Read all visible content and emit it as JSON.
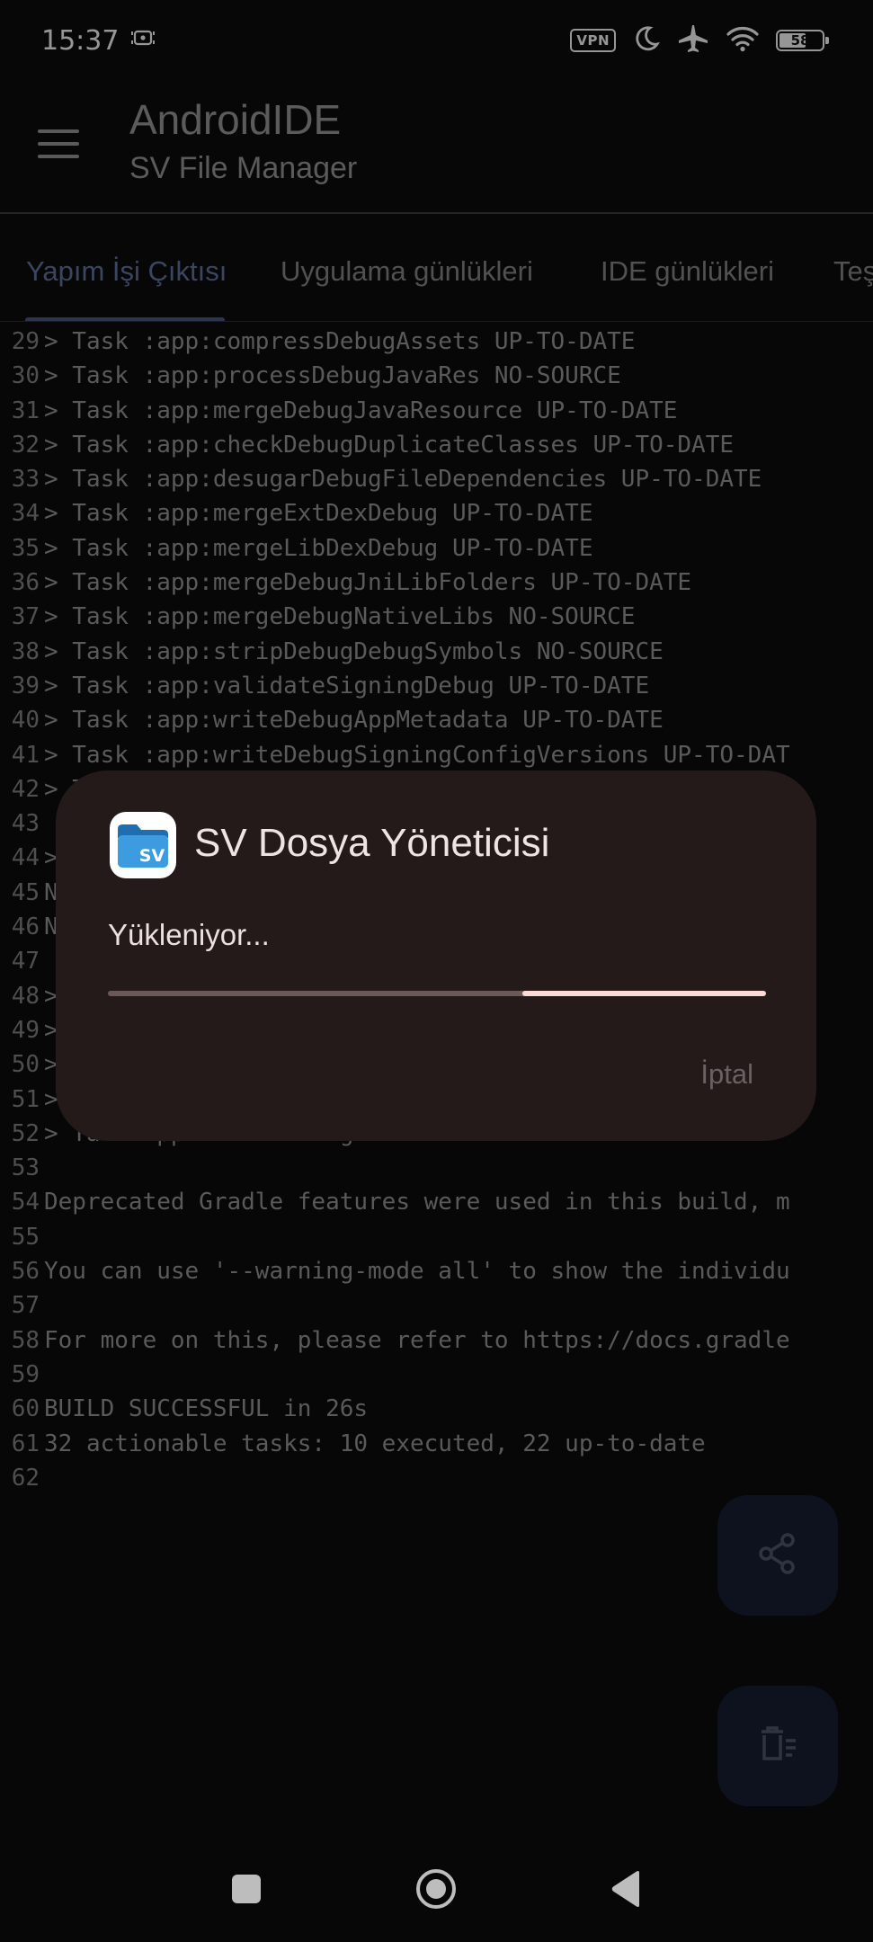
{
  "status_bar": {
    "time": "15:37",
    "vpn_label": "VPN",
    "battery_level": "58",
    "battery_fraction": 0.58,
    "icons": [
      "screencast-icon",
      "vpn-icon",
      "moon-icon",
      "airplane-icon",
      "wifi-icon",
      "battery-icon"
    ]
  },
  "toolbar": {
    "title": "AndroidIDE",
    "subtitle": "SV File Manager",
    "menu_icon": "hamburger-menu-icon"
  },
  "tabs": [
    {
      "label": "Yapım İşi Çıktısı",
      "active": true
    },
    {
      "label": "Uygulama günlükleri",
      "active": false
    },
    {
      "label": "IDE günlükleri",
      "active": false
    },
    {
      "label": "Teş",
      "active": false
    }
  ],
  "log": [
    {
      "n": "29",
      "text": "> Task :app:compressDebugAssets UP-TO-DATE"
    },
    {
      "n": "30",
      "text": "> Task :app:processDebugJavaRes NO-SOURCE"
    },
    {
      "n": "31",
      "text": "> Task :app:mergeDebugJavaResource UP-TO-DATE"
    },
    {
      "n": "32",
      "text": "> Task :app:checkDebugDuplicateClasses UP-TO-DATE"
    },
    {
      "n": "33",
      "text": "> Task :app:desugarDebugFileDependencies UP-TO-DATE"
    },
    {
      "n": "34",
      "text": "> Task :app:mergeExtDexDebug UP-TO-DATE"
    },
    {
      "n": "35",
      "text": "> Task :app:mergeLibDexDebug UP-TO-DATE"
    },
    {
      "n": "36",
      "text": "> Task :app:mergeDebugJniLibFolders UP-TO-DATE"
    },
    {
      "n": "37",
      "text": "> Task :app:mergeDebugNativeLibs NO-SOURCE"
    },
    {
      "n": "38",
      "text": "> Task :app:stripDebugDebugSymbols NO-SOURCE"
    },
    {
      "n": "39",
      "text": "> Task :app:validateSigningDebug UP-TO-DATE"
    },
    {
      "n": "40",
      "text": "> Task :app:writeDebugAppMetadata UP-TO-DATE"
    },
    {
      "n": "41",
      "text": "> Task :app:writeDebugSigningConfigVersions UP-TO-DAT"
    },
    {
      "n": "42",
      "text": "> T"
    },
    {
      "n": "43",
      "text": ""
    },
    {
      "n": "44",
      "text": ">"
    },
    {
      "n": "45",
      "text": "N                                          ed A"
    },
    {
      "n": "46",
      "text": "N                                          ls."
    },
    {
      "n": "47",
      "text": ""
    },
    {
      "n": "48",
      "text": ">"
    },
    {
      "n": "49",
      "text": ">"
    },
    {
      "n": "50",
      "text": ">"
    },
    {
      "n": "51",
      "text": ">                                          TO-D"
    },
    {
      "n": "52",
      "text": "> Ta    pp           g"
    },
    {
      "n": "53",
      "text": ""
    },
    {
      "n": "54",
      "text": "Deprecated Gradle features were used in this build, m"
    },
    {
      "n": "55",
      "text": ""
    },
    {
      "n": "56",
      "text": "You can use '--warning-mode all' to show the individu"
    },
    {
      "n": "57",
      "text": ""
    },
    {
      "n": "58",
      "text": "For more on this, please refer to https://docs.gradle"
    },
    {
      "n": "59",
      "text": ""
    },
    {
      "n": "60",
      "text": "BUILD SUCCESSFUL in 26s"
    },
    {
      "n": "61",
      "text": "32 actionable tasks: 10 executed, 22 up-to-date"
    },
    {
      "n": "62",
      "text": ""
    }
  ],
  "dialog": {
    "app_icon": "sv-folder-app-icon",
    "app_icon_text": "SV",
    "title": "SV Dosya Yöneticisi",
    "message": "Yükleniyor...",
    "progress_indeterminate_segment": [
      0.63,
      1.0
    ],
    "cancel_label": "İptal"
  },
  "fabs": {
    "share_icon": "share-icon",
    "clear_icon": "clear-log-icon"
  },
  "nav_bar": {
    "icons": [
      "recents-square-icon",
      "home-circle-icon",
      "back-triangle-icon"
    ]
  },
  "colors": {
    "background": "#0b0b0b",
    "active_tab": "#5d6b94",
    "dialog_bg": "#241a19",
    "progress_fill": "#fbd9d4",
    "fab_bg": "#161d2e"
  }
}
